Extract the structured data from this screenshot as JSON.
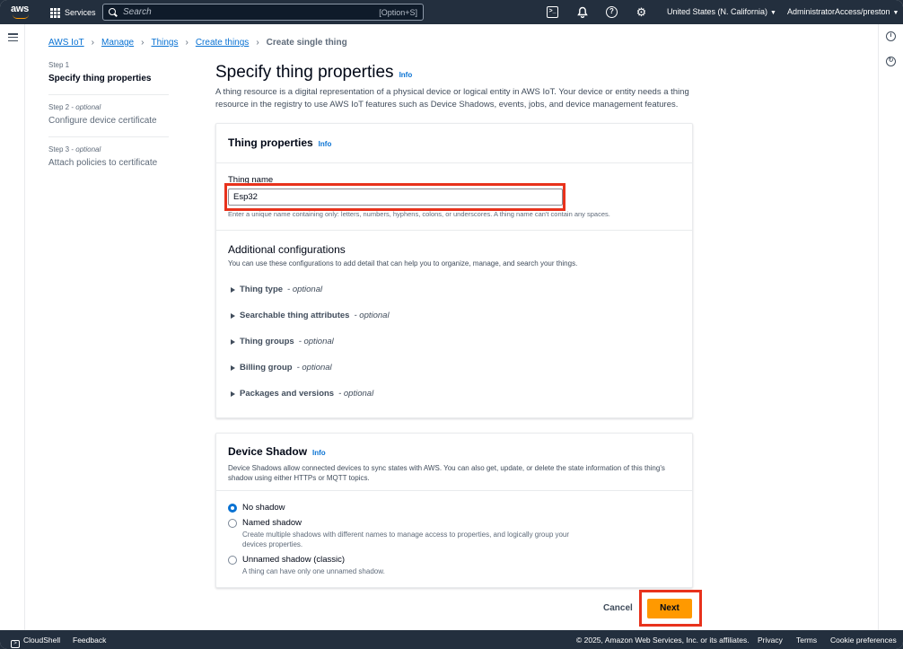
{
  "topbar": {
    "logo": "aws",
    "services_label": "Services",
    "search_placeholder": "Search",
    "search_shortcut": "[Option+S]",
    "region": "United States (N. California)",
    "account": "AdministratorAccess/preston"
  },
  "breadcrumb": {
    "items": [
      "AWS IoT",
      "Manage",
      "Things",
      "Create things"
    ],
    "current": "Create single thing"
  },
  "steps": [
    {
      "num": "Step 1",
      "optional": "",
      "title": "Specify thing properties",
      "active": true
    },
    {
      "num": "Step 2",
      "optional": "optional",
      "title": "Configure device certificate",
      "active": false
    },
    {
      "num": "Step 3",
      "optional": "optional",
      "title": "Attach policies to certificate",
      "active": false
    }
  ],
  "page": {
    "title": "Specify thing properties",
    "info": "Info",
    "description": "A thing resource is a digital representation of a physical device or logical entity in AWS IoT. Your device or entity needs a thing resource in the registry to use AWS IoT features such as Device Shadows, events, jobs, and device management features."
  },
  "thing_properties": {
    "title": "Thing properties",
    "info": "Info",
    "name_label": "Thing name",
    "name_value": "Esp32",
    "name_hint": "Enter a unique name containing only: letters, numbers, hyphens, colons, or underscores. A thing name can't contain any spaces.",
    "additional_title": "Additional configurations",
    "additional_desc": "You can use these configurations to add detail that can help you to organize, manage, and search your things.",
    "expanders": [
      {
        "label": "Thing type",
        "suffix": "- optional"
      },
      {
        "label": "Searchable thing attributes",
        "suffix": "- optional"
      },
      {
        "label": "Thing groups",
        "suffix": "- optional"
      },
      {
        "label": "Billing group",
        "suffix": "- optional"
      },
      {
        "label": "Packages and versions",
        "suffix": "- optional"
      }
    ]
  },
  "device_shadow": {
    "title": "Device Shadow",
    "info": "Info",
    "description": "Device Shadows allow connected devices to sync states with AWS. You can also get, update, or delete the state information of this thing's shadow using either HTTPs or MQTT topics.",
    "options": [
      {
        "label": "No shadow",
        "desc": "",
        "selected": true
      },
      {
        "label": "Named shadow",
        "desc": "Create multiple shadows with different names to manage access to properties, and logically group your devices properties.",
        "selected": false
      },
      {
        "label": "Unnamed shadow (classic)",
        "desc": "A thing can have only one unnamed shadow.",
        "selected": false
      }
    ]
  },
  "actions": {
    "cancel": "Cancel",
    "next": "Next"
  },
  "footer": {
    "cloudshell": "CloudShell",
    "feedback": "Feedback",
    "copyright": "© 2025, Amazon Web Services, Inc. or its affiliates.",
    "privacy": "Privacy",
    "terms": "Terms",
    "cookies": "Cookie preferences"
  },
  "colors": {
    "accent": "#0972d3",
    "primary_button": "#ff9900",
    "nav": "#232f3e",
    "highlight": "#e8321c"
  }
}
